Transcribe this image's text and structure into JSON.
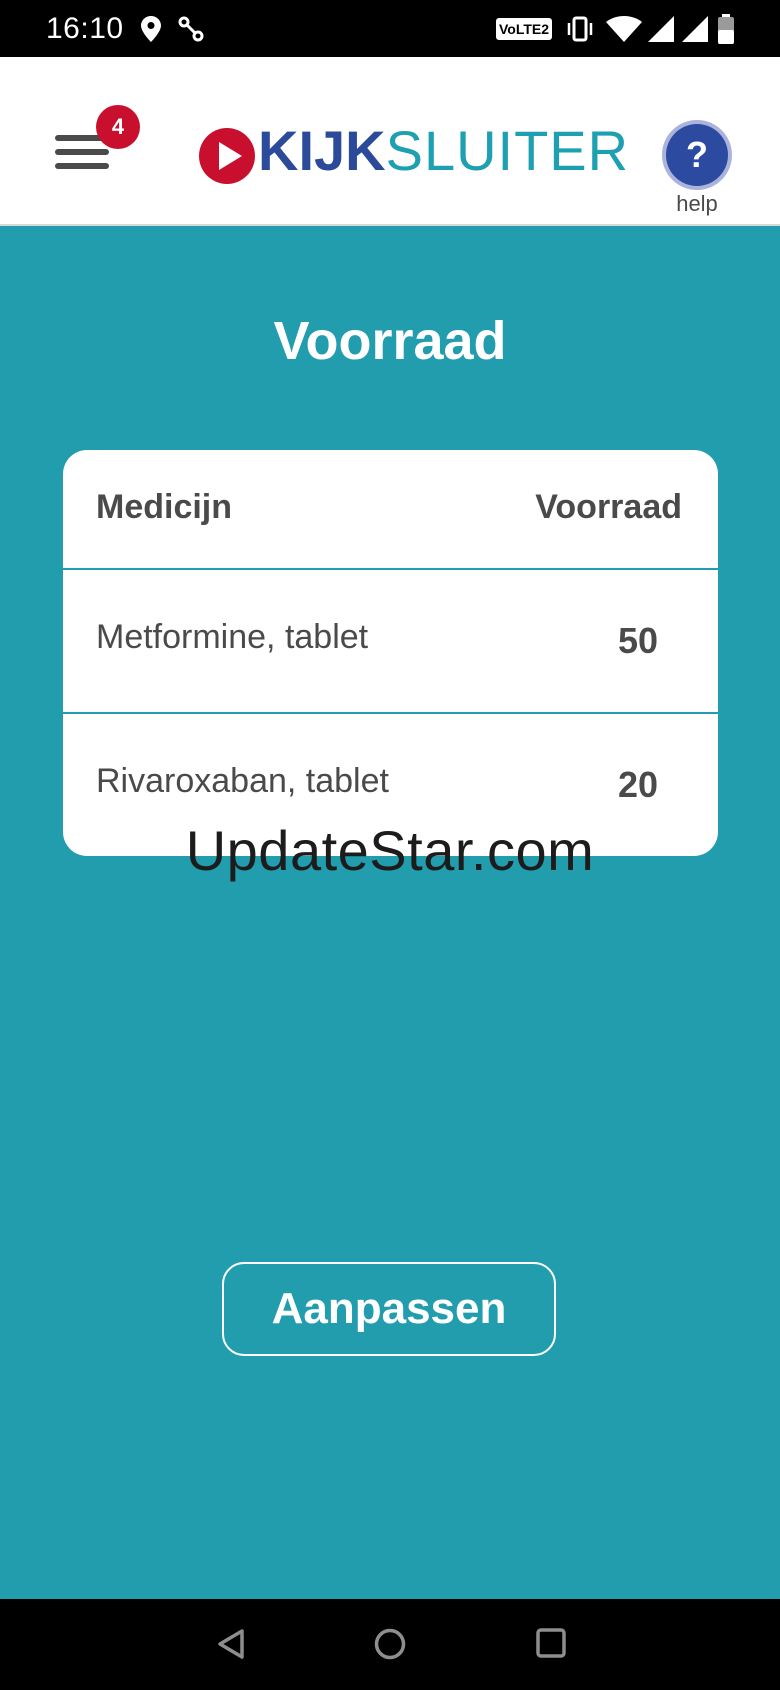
{
  "status_bar": {
    "time": "16:10",
    "network_badge": "VoLTE2",
    "icons": [
      "location-icon",
      "link-icon",
      "vibrate-icon",
      "wifi-icon",
      "signal-icon",
      "signal-icon-2",
      "battery-icon"
    ]
  },
  "header": {
    "menu_badge_count": "4",
    "logo_kijk": "KIJK",
    "logo_sluiter": "SLUITER",
    "help_icon": "?",
    "help_label": "help",
    "brand_colors": {
      "red": "#c8102e",
      "blue": "#2c4a9a",
      "teal": "#1fa0b2"
    }
  },
  "main": {
    "title": "Voorraad",
    "table": {
      "headers": {
        "medicine": "Medicijn",
        "stock": "Voorraad"
      },
      "rows": [
        {
          "medicine": "Metformine, tablet",
          "stock": "50"
        },
        {
          "medicine": "Rivaroxaban, tablet",
          "stock": "20"
        }
      ]
    },
    "watermark": "UpdateStar.com",
    "adjust_button": "Aanpassen"
  },
  "nav_bar": {
    "icons": [
      "back-icon",
      "home-icon",
      "recents-icon"
    ]
  },
  "colors": {
    "background": "#219dae",
    "card": "#ffffff",
    "text": "#4a4a4a"
  }
}
